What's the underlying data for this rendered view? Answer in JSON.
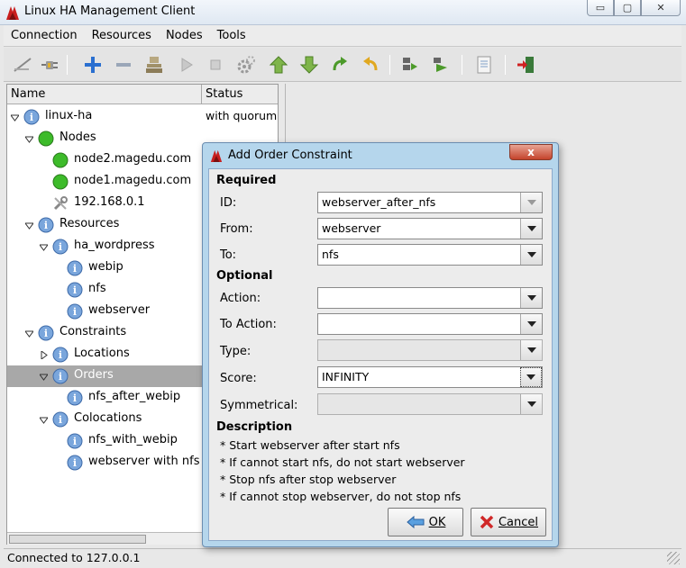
{
  "window": {
    "title": "Linux HA Management Client",
    "minimize": "▭",
    "maximize": "▢",
    "close": "✕"
  },
  "menu": [
    "Connection",
    "Resources",
    "Nodes",
    "Tools"
  ],
  "toolbar_icons": [
    "disconnect-icon",
    "plug-icon",
    "add-icon",
    "remove-icon",
    "cleanup-icon",
    "start-icon",
    "stop-icon",
    "gear-icon",
    "move-up-icon",
    "move-down-icon",
    "redo-icon",
    "undo-icon",
    "standby-icon",
    "active-icon",
    "document-icon",
    "exit-icon"
  ],
  "tree": {
    "col_name": "Name",
    "col_status": "Status",
    "items": [
      {
        "label": "linux-ha",
        "status": "with quorum"
      },
      {
        "label": "Nodes"
      },
      {
        "label": "node2.magedu.com"
      },
      {
        "label": "node1.magedu.com"
      },
      {
        "label": "192.168.0.1"
      },
      {
        "label": "Resources"
      },
      {
        "label": "ha_wordpress"
      },
      {
        "label": "webip"
      },
      {
        "label": "nfs"
      },
      {
        "label": "webserver"
      },
      {
        "label": "Constraints"
      },
      {
        "label": "Locations"
      },
      {
        "label": "Orders"
      },
      {
        "label": "nfs_after_webip"
      },
      {
        "label": "Colocations"
      },
      {
        "label": "nfs_with_webip"
      },
      {
        "label": "webserver with nfs"
      }
    ]
  },
  "statusbar": {
    "text": "Connected to 127.0.0.1"
  },
  "dialog": {
    "title": "Add Order Constraint",
    "close": "x",
    "required_label": "Required",
    "optional_label": "Optional",
    "fields": {
      "id": {
        "label": "ID:",
        "value": "webserver_after_nfs"
      },
      "from": {
        "label": "From:",
        "value": "webserver"
      },
      "to": {
        "label": "To:",
        "value": "nfs"
      },
      "action": {
        "label": "Action:",
        "value": ""
      },
      "to_action": {
        "label": "To Action:",
        "value": ""
      },
      "type": {
        "label": "Type:",
        "value": ""
      },
      "score": {
        "label": "Score:",
        "value": "INFINITY"
      },
      "symmetrical": {
        "label": "Symmetrical:",
        "value": ""
      }
    },
    "description_label": "Description",
    "description": [
      "* Start webserver after start nfs",
      "* If cannot start nfs, do not start webserver",
      "* Stop nfs after stop webserver",
      "* If cannot stop webserver, do not stop nfs"
    ],
    "ok_label": "OK",
    "cancel_label": "Cancel"
  }
}
